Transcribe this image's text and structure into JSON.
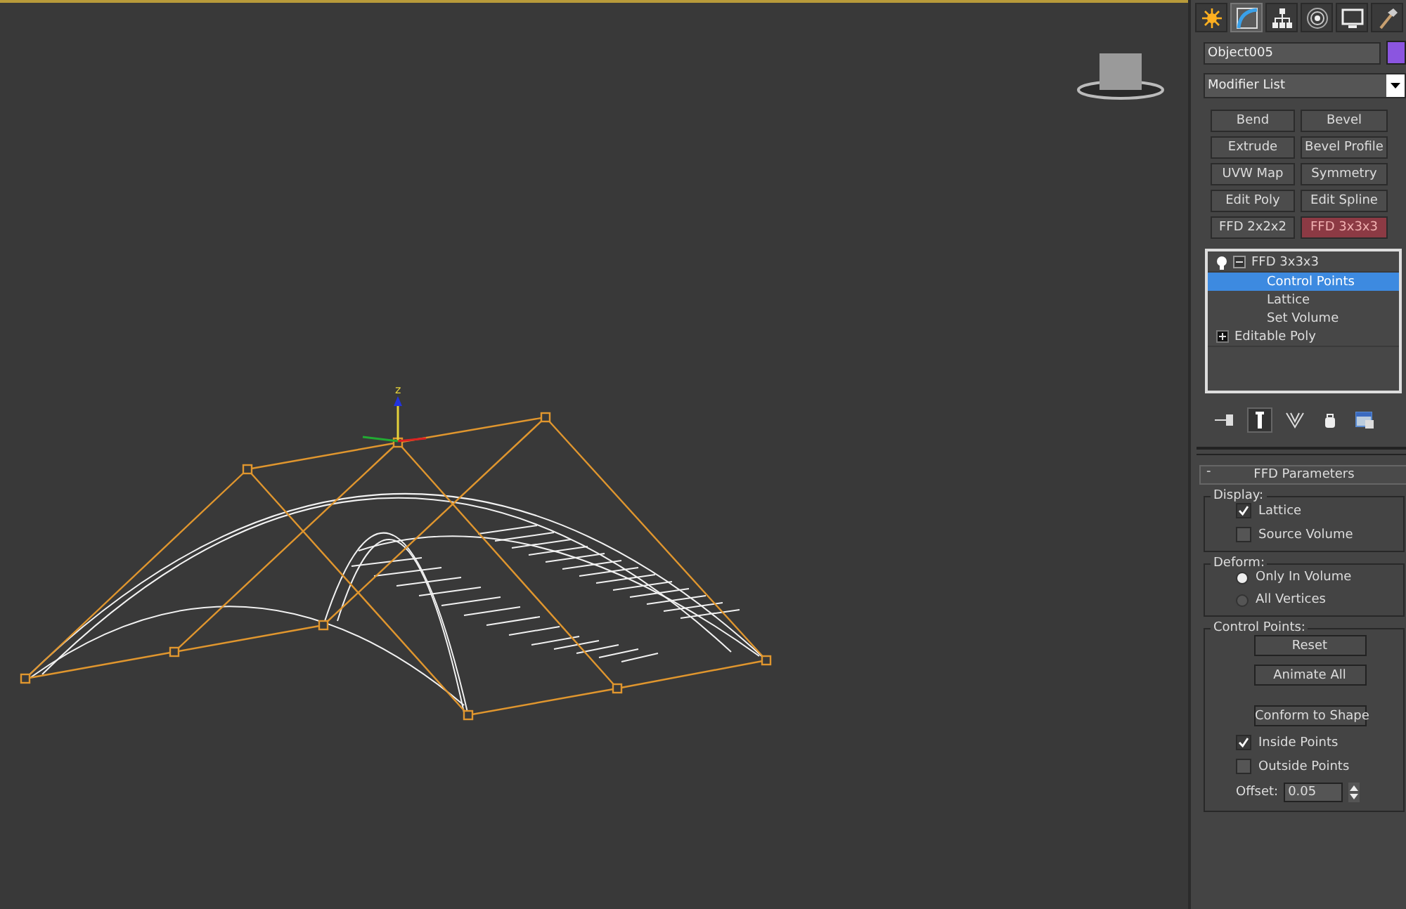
{
  "viewport": {
    "active": true,
    "gizmo_label": "z"
  },
  "command_panel": {
    "tabs": [
      {
        "kind": "create",
        "selected": false
      },
      {
        "kind": "modify",
        "selected": true
      },
      {
        "kind": "hierarchy",
        "selected": false
      },
      {
        "kind": "motion",
        "selected": false
      },
      {
        "kind": "display",
        "selected": false
      },
      {
        "kind": "utilities",
        "selected": false
      }
    ],
    "object": {
      "name": "Object005",
      "color": "#8b55e0"
    },
    "modifier_list": "Modifier List",
    "modifier_buttons": [
      {
        "label": "Bend",
        "selected": false
      },
      {
        "label": "Bevel",
        "selected": false
      },
      {
        "label": "Extrude",
        "selected": false
      },
      {
        "label": "Bevel Profile",
        "selected": false
      },
      {
        "label": "UVW Map",
        "selected": false
      },
      {
        "label": "Symmetry",
        "selected": false
      },
      {
        "label": "Edit Poly",
        "selected": false
      },
      {
        "label": "Edit Spline",
        "selected": false
      },
      {
        "label": "FFD 2x2x2",
        "selected": false
      },
      {
        "label": "FFD 3x3x3",
        "selected": true
      }
    ],
    "stack": [
      {
        "label": "FFD 3x3x3",
        "expanded": true,
        "selected": false,
        "children": [
          {
            "label": "Control Points",
            "selected": true
          },
          {
            "label": "Lattice",
            "selected": false
          },
          {
            "label": "Set Volume",
            "selected": false
          }
        ]
      },
      {
        "label": "Editable Poly",
        "expanded": false,
        "selected": false
      }
    ],
    "stack_tools": [
      {
        "kind": "pin",
        "pressed": false
      },
      {
        "kind": "show-end-result",
        "pressed": true
      },
      {
        "kind": "make-unique",
        "pressed": false
      },
      {
        "kind": "remove",
        "pressed": false
      },
      {
        "kind": "configure",
        "pressed": false
      }
    ],
    "rollout": {
      "sign": "-",
      "title": "FFD Parameters",
      "groups": [
        {
          "title": "Display:",
          "items": [
            {
              "kind": "checkbox",
              "label": "Lattice",
              "checked": true
            },
            {
              "kind": "checkbox",
              "label": "Source Volume",
              "checked": false
            }
          ]
        },
        {
          "title": "Deform:",
          "items": [
            {
              "kind": "radio",
              "label": "Only In Volume",
              "selected": true
            },
            {
              "kind": "radio",
              "label": "All Vertices",
              "selected": false
            }
          ]
        },
        {
          "title": "Control Points:",
          "items": [
            {
              "kind": "button",
              "label": "Reset"
            },
            {
              "kind": "button",
              "label": "Animate All"
            },
            {
              "kind": "spacer"
            },
            {
              "kind": "button",
              "label": "Conform to Shape"
            },
            {
              "kind": "checkbox",
              "label": "Inside Points",
              "checked": true
            },
            {
              "kind": "checkbox",
              "label": "Outside Points",
              "checked": false
            },
            {
              "kind": "spinner",
              "label": "Offset:",
              "value": "0.05"
            }
          ]
        }
      ]
    }
  }
}
